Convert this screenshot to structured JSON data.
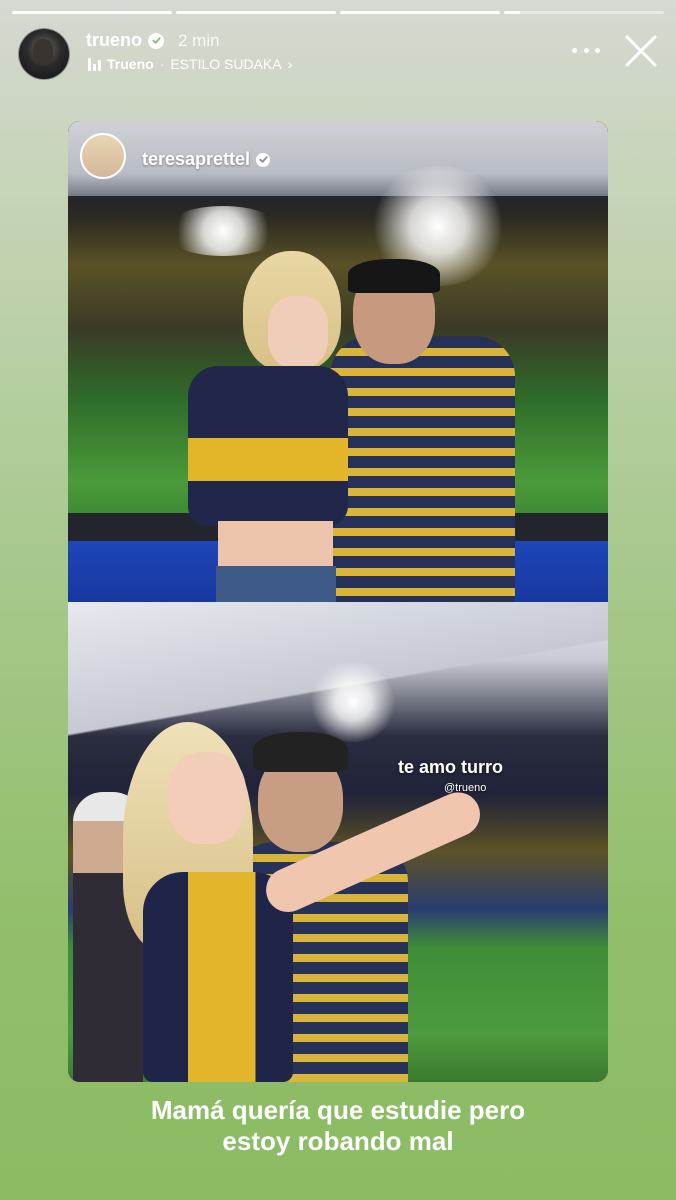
{
  "progress": {
    "segments": [
      {
        "fill": 1.0
      },
      {
        "fill": 1.0
      },
      {
        "fill": 1.0
      },
      {
        "fill": 0.1
      }
    ]
  },
  "header": {
    "username": "trueno",
    "time": "2 min",
    "music": {
      "artist": "Trueno",
      "separator": "·",
      "song": "ESTILO SUDAKA",
      "chevron": "›"
    }
  },
  "card": {
    "tag": {
      "username": "teresaprettel"
    },
    "photo2": {
      "caption": "te amo turro",
      "mention": "@trueno"
    }
  },
  "story_text": {
    "line1": "Mamá quería que estudie pero",
    "line2": "estoy robando mal"
  },
  "colors": {
    "background_top": "#d5d9d2",
    "background_bottom": "#8bbb63",
    "text": "#ffffff"
  },
  "icons": {
    "verified": "verified-badge-icon",
    "music": "music-bars-icon",
    "more": "more-dots-icon",
    "close": "close-icon"
  }
}
